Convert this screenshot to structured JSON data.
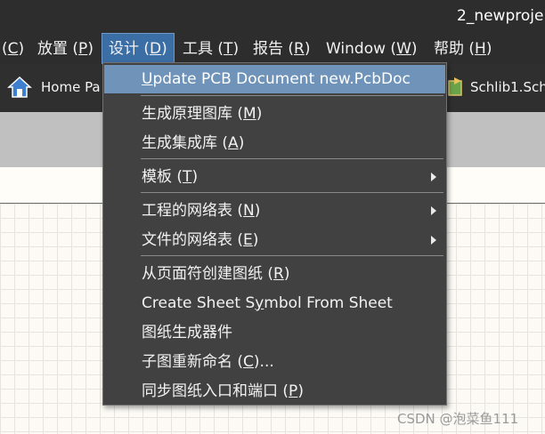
{
  "window": {
    "title": "2_newproje"
  },
  "menubar": {
    "items": [
      {
        "label": "(C)",
        "hotkey": "C",
        "prefix": "(",
        "suffix": ")"
      },
      {
        "label": "放置 (P)",
        "text": "放置 (",
        "hotkey": "P",
        "suffix": ")"
      },
      {
        "label": "设计 (D)",
        "text": "设计 (",
        "hotkey": "D",
        "suffix": ")"
      },
      {
        "label": "工具 (T)",
        "text": "工具 (",
        "hotkey": "T",
        "suffix": ")"
      },
      {
        "label": "报告 (R)",
        "text": "报告 (",
        "hotkey": "R",
        "suffix": ")"
      },
      {
        "label": "Window (W)",
        "text": "Window (",
        "hotkey": "W",
        "suffix": ")"
      },
      {
        "label": "帮助 (H)",
        "text": "帮助 (",
        "hotkey": "H",
        "suffix": ")"
      }
    ]
  },
  "tabs": [
    {
      "label": "Home Pa",
      "icon": "home-icon"
    },
    {
      "label": "Schlib1.Sch",
      "icon": "schlib-icon"
    }
  ],
  "design_menu": {
    "items": [
      {
        "pre": "",
        "hotkey": "U",
        "post": "pdate PCB Document new.PcbDoc"
      },
      {
        "pre": "生成原理图库 (",
        "hotkey": "M",
        "post": ")"
      },
      {
        "pre": "生成集成库 (",
        "hotkey": "A",
        "post": ")"
      },
      {
        "pre": "模板 (",
        "hotkey": "T",
        "post": ")"
      },
      {
        "pre": "工程的网络表 (",
        "hotkey": "N",
        "post": ")"
      },
      {
        "pre": "文件的网络表 (",
        "hotkey": "E",
        "post": ")"
      },
      {
        "pre": "从页面符创建图纸 (",
        "hotkey": "R",
        "post": ")"
      },
      {
        "pre": "Create Sheet S",
        "hotkey": "y",
        "post": "mbol From Sheet"
      },
      {
        "pre": "图纸生成器件",
        "hotkey": "",
        "post": ""
      },
      {
        "pre": "子图重新命名 (",
        "hotkey": "C",
        "post": ")..."
      },
      {
        "pre": "同步图纸入口和端口 (",
        "hotkey": "P",
        "post": ")"
      }
    ]
  },
  "watermark": "CSDN @泡菜鱼111",
  "colors": {
    "menu_bg": "#414141",
    "highlight": "#6f93b9",
    "active_menu": "#3c6ea6",
    "bar_bg": "#2d2d2d"
  }
}
